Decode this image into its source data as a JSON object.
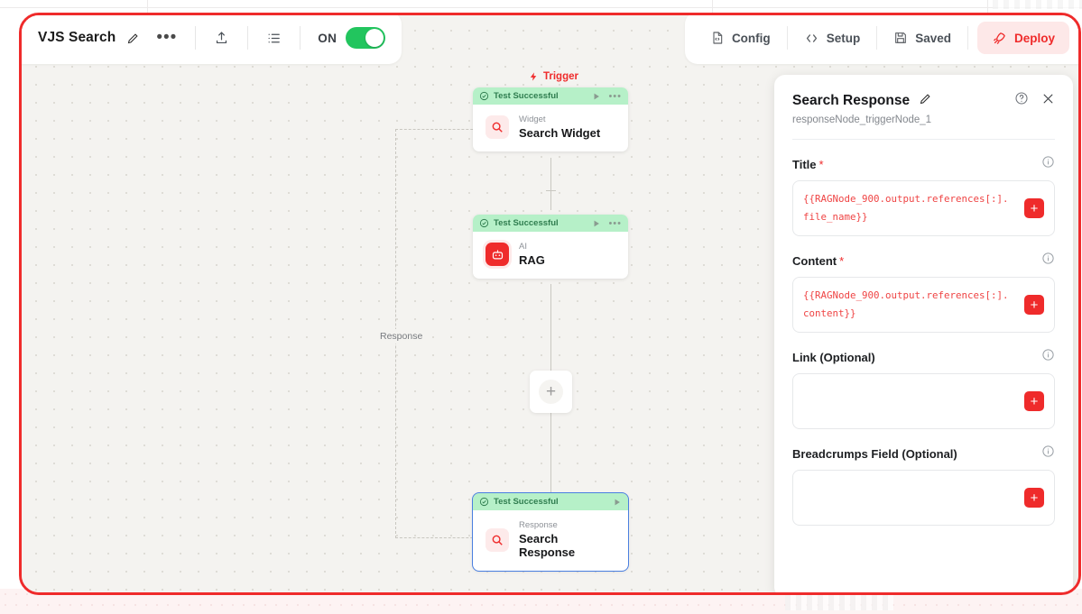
{
  "backdrop": {
    "note": "faint underlying page"
  },
  "toolbar": {
    "workflow_title": "VJS Search",
    "edit_icon": "pencil-icon",
    "more_icon": "ellipsis-icon",
    "upload_icon": "upload-icon",
    "list_icon": "list-icon",
    "toggle_label": "ON",
    "toggle_on": true,
    "toggle_color": "#22c55e",
    "right_items": [
      {
        "label": "Config",
        "icon": "code-file-icon"
      },
      {
        "label": "Setup",
        "icon": "code-brackets-icon"
      },
      {
        "label": "Saved",
        "icon": "save-disk-icon"
      }
    ],
    "deploy": {
      "label": "Deploy",
      "icon": "rocket-icon",
      "color": "#ef2b2b",
      "bg": "#fde8e8"
    }
  },
  "canvas": {
    "trigger_label": "Trigger",
    "trigger_icon": "lightning-icon",
    "response_edge_label": "Response",
    "add_node_icon": "plus-icon",
    "nodes": [
      {
        "status": "Test Successful",
        "status_icon": "check-circle-icon",
        "run_icon": "play-icon",
        "menu_icon": "ellipsis-icon",
        "kicker": "Widget",
        "name": "Search Widget",
        "node_icon": "search-icon",
        "icon_style": "soft",
        "selected": false,
        "has_menu": true
      },
      {
        "status": "Test Successful",
        "status_icon": "check-circle-icon",
        "run_icon": "play-icon",
        "menu_icon": "ellipsis-icon",
        "kicker": "AI",
        "name": "RAG",
        "node_icon": "robot-icon",
        "icon_style": "solid",
        "selected": false,
        "has_menu": true
      },
      {
        "status": "Test Successful",
        "status_icon": "check-circle-icon",
        "run_icon": "play-icon",
        "menu_icon": "",
        "kicker": "Response",
        "name": "Search Response",
        "node_icon": "search-icon",
        "icon_style": "soft",
        "selected": true,
        "has_menu": false
      }
    ]
  },
  "panel": {
    "title": "Search Response",
    "edit_icon": "pencil-icon",
    "help_icon": "help-circle-icon",
    "close_icon": "close-icon",
    "subtitle": "responseNode_triggerNode_1",
    "fields": [
      {
        "label": "Title",
        "required": true,
        "info_icon": "info-circle-icon",
        "value": "{{RAGNode_900.output.references[:].file_name}}",
        "add_icon": "plus-icon"
      },
      {
        "label": "Content",
        "required": true,
        "info_icon": "info-circle-icon",
        "value": "{{RAGNode_900.output.references[:].content}}",
        "add_icon": "plus-icon"
      },
      {
        "label": "Link (Optional)",
        "required": false,
        "info_icon": "info-circle-icon",
        "value": "",
        "add_icon": "plus-icon"
      },
      {
        "label": "Breadcrumps Field (Optional)",
        "required": false,
        "info_icon": "info-circle-icon",
        "value": "",
        "add_icon": "plus-icon"
      }
    ]
  }
}
